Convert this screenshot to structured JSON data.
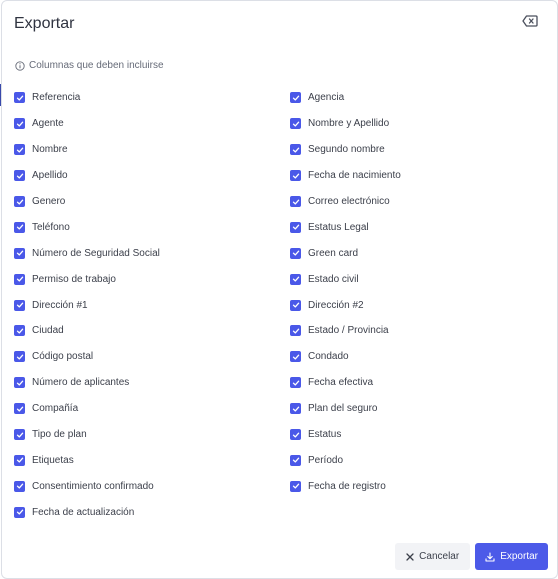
{
  "dialog": {
    "title": "Exportar",
    "section_label": "Columnas que deben incluirse"
  },
  "columns_left": [
    {
      "label": "Referencia",
      "checked": true
    },
    {
      "label": "Agente",
      "checked": true
    },
    {
      "label": "Nombre",
      "checked": true
    },
    {
      "label": "Apellido",
      "checked": true
    },
    {
      "label": "Genero",
      "checked": true
    },
    {
      "label": "Teléfono",
      "checked": true
    },
    {
      "label": "Número de Seguridad Social",
      "checked": true
    },
    {
      "label": "Permiso de trabajo",
      "checked": true
    },
    {
      "label": "Dirección #1",
      "checked": true
    },
    {
      "label": "Ciudad",
      "checked": true
    },
    {
      "label": "Código postal",
      "checked": true
    },
    {
      "label": "Número de aplicantes",
      "checked": true
    },
    {
      "label": "Compañía",
      "checked": true
    },
    {
      "label": "Tipo de plan",
      "checked": true
    },
    {
      "label": "Etiquetas",
      "checked": true
    },
    {
      "label": "Consentimiento confirmado",
      "checked": true
    },
    {
      "label": "Fecha de actualización",
      "checked": true
    }
  ],
  "columns_right": [
    {
      "label": "Agencia",
      "checked": true
    },
    {
      "label": "Nombre y Apellido",
      "checked": true
    },
    {
      "label": "Segundo nombre",
      "checked": true
    },
    {
      "label": "Fecha de nacimiento",
      "checked": true
    },
    {
      "label": "Correo electrónico",
      "checked": true
    },
    {
      "label": "Estatus Legal",
      "checked": true
    },
    {
      "label": "Green card",
      "checked": true
    },
    {
      "label": "Estado civil",
      "checked": true
    },
    {
      "label": "Dirección #2",
      "checked": true
    },
    {
      "label": "Estado / Provincia",
      "checked": true
    },
    {
      "label": "Condado",
      "checked": true
    },
    {
      "label": "Fecha efectiva",
      "checked": true
    },
    {
      "label": "Plan del seguro",
      "checked": true
    },
    {
      "label": "Estatus",
      "checked": true
    },
    {
      "label": "Período",
      "checked": true
    },
    {
      "label": "Fecha de registro",
      "checked": true
    }
  ],
  "footer": {
    "cancel_label": "Cancelar",
    "export_label": "Exportar"
  },
  "colors": {
    "accent": "#4c5ae8",
    "checkbox": "#4a58e8"
  }
}
